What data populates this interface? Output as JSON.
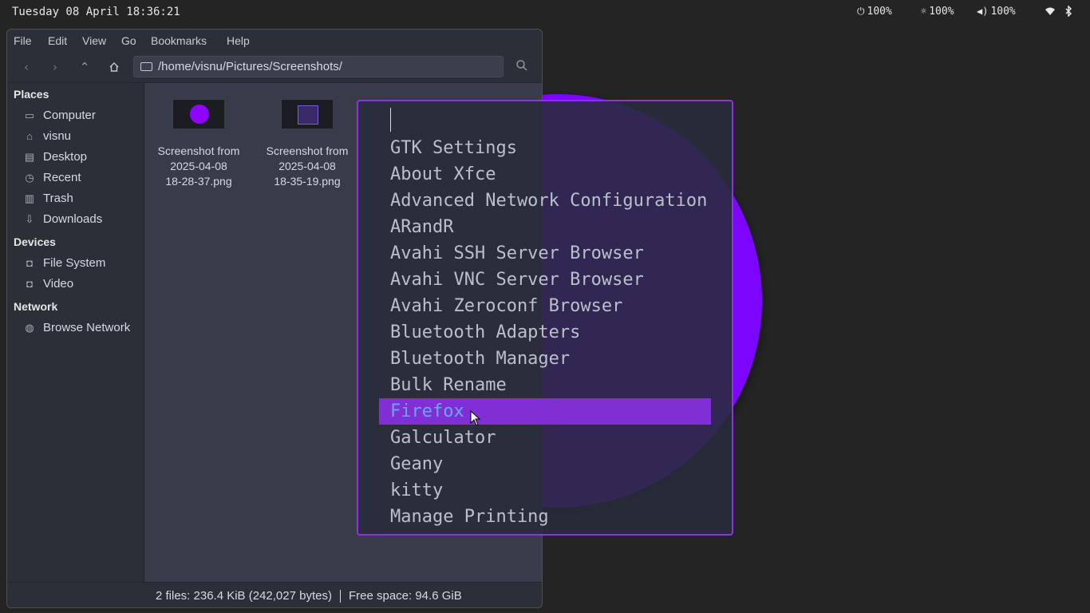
{
  "topbar": {
    "clock": "Tuesday 08 April 18:36:21",
    "power": "100%",
    "brightness": "100%",
    "volume": "100%",
    "icons": {
      "power": "plug-icon",
      "brightness": "brightness-icon",
      "volume": "speaker-icon",
      "wifi": "wifi-icon",
      "bluetooth": "bluetooth-icon"
    }
  },
  "filemanager": {
    "menus": [
      "File",
      "Edit",
      "View",
      "Go",
      "Bookmarks",
      "Help"
    ],
    "path": "/home/visnu/Pictures/Screenshots/",
    "sidebar": {
      "places_heading": "Places",
      "places": [
        {
          "label": "Computer",
          "icon": "computer-icon"
        },
        {
          "label": "visnu",
          "icon": "home-icon"
        },
        {
          "label": "Desktop",
          "icon": "desktop-icon"
        },
        {
          "label": "Recent",
          "icon": "recent-icon"
        },
        {
          "label": "Trash",
          "icon": "trash-icon"
        },
        {
          "label": "Downloads",
          "icon": "download-icon"
        }
      ],
      "devices_heading": "Devices",
      "devices": [
        {
          "label": "File System",
          "icon": "drive-icon"
        },
        {
          "label": "Video",
          "icon": "drive-icon"
        }
      ],
      "network_heading": "Network",
      "network": [
        {
          "label": "Browse Network",
          "icon": "network-icon"
        }
      ]
    },
    "files": [
      {
        "line1": "Screenshot from",
        "line2": "2025-04-08",
        "line3": "18-28-37.png"
      },
      {
        "line1": "Screenshot from",
        "line2": "2025-04-08",
        "line3": "18-35-19.png"
      }
    ],
    "status": {
      "files": "2 files: 236.4 KiB (242,027 bytes)",
      "free": "Free space: 94.6 GiB"
    }
  },
  "launcher": {
    "query": "",
    "items": [
      "GTK Settings",
      "About Xfce",
      "Advanced Network Configuration",
      "ARandR",
      "Avahi SSH Server Browser",
      "Avahi VNC Server Browser",
      "Avahi Zeroconf Browser",
      "Bluetooth Adapters",
      "Bluetooth Manager",
      "Bulk Rename",
      "Firefox",
      "Galculator",
      "Geany",
      "kitty",
      "Manage Printing"
    ],
    "selected_index": 10
  },
  "colors": {
    "accent": "#8f31e6",
    "selection": "#7f2fd3",
    "disc": "#7c05ff"
  }
}
